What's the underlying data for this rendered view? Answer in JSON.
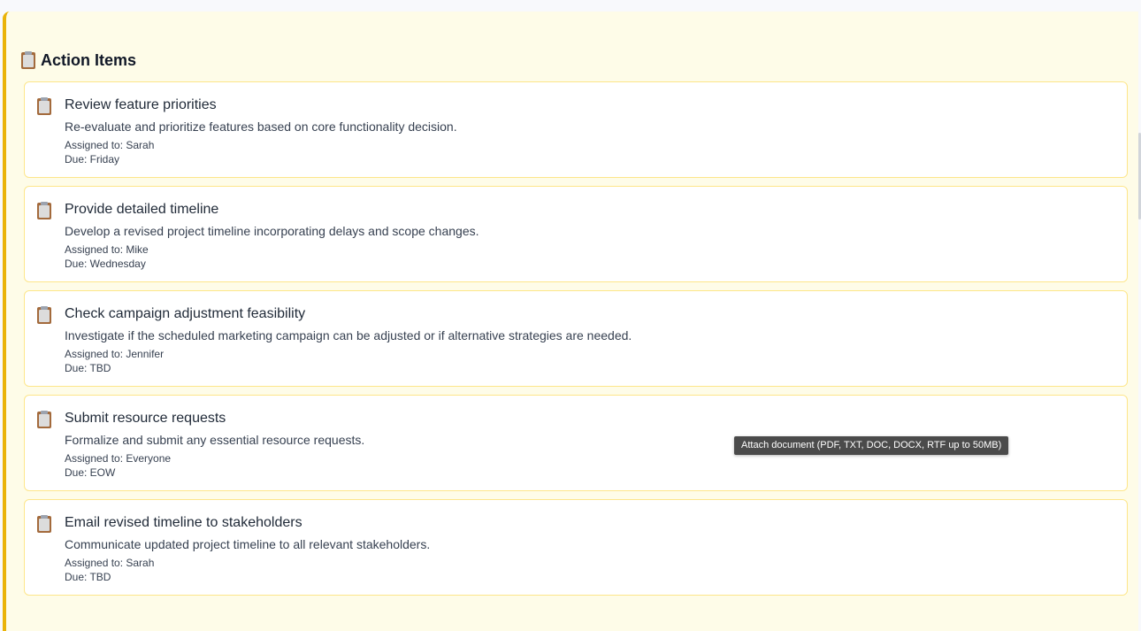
{
  "section": {
    "title": "Action Items",
    "icon": "clipboard-icon"
  },
  "action_items": [
    {
      "title": "Review feature priorities",
      "description": "Re-evaluate and prioritize features based on core functionality decision.",
      "assigned": "Assigned to: Sarah",
      "due": "Due: Friday"
    },
    {
      "title": "Provide detailed timeline",
      "description": "Develop a revised project timeline incorporating delays and scope changes.",
      "assigned": "Assigned to: Mike",
      "due": "Due: Wednesday"
    },
    {
      "title": "Check campaign adjustment feasibility",
      "description": "Investigate if the scheduled marketing campaign can be adjusted or if alternative strategies are needed.",
      "assigned": "Assigned to: Jennifer",
      "due": "Due: TBD"
    },
    {
      "title": "Submit resource requests",
      "description": "Formalize and submit any essential resource requests.",
      "assigned": "Assigned to: Everyone",
      "due": "Due: EOW"
    },
    {
      "title": "Email revised timeline to stakeholders",
      "description": "Communicate updated project timeline to all relevant stakeholders.",
      "assigned": "Assigned to: Sarah",
      "due": "Due: TBD"
    }
  ],
  "tooltip": {
    "text": "Attach document (PDF, TXT, DOC, DOCX, RTF up to 50MB)"
  },
  "colors": {
    "panel_background": "#fefce8",
    "accent_border": "#eab308",
    "card_border": "#fde68a"
  }
}
